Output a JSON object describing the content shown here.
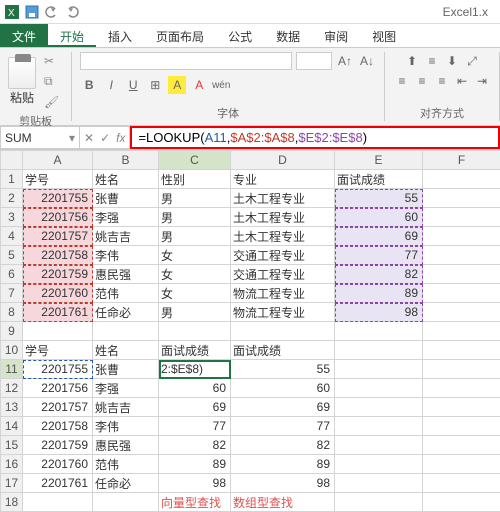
{
  "app": {
    "title": "Excel1.x"
  },
  "tabs": {
    "file": "文件",
    "home": "开始",
    "insert": "插入",
    "layout": "页面布局",
    "formulas": "公式",
    "data": "数据",
    "review": "审阅",
    "view": "视图"
  },
  "ribbon": {
    "paste_label": "粘贴",
    "clipboard_group": "剪贴板",
    "font_group": "字体",
    "align_group": "对齐方式",
    "bold": "B",
    "italic": "I",
    "underline": "U"
  },
  "formula_bar": {
    "name_box": "SUM",
    "cancel": "✕",
    "confirm": "✓",
    "fx": "fx",
    "formula_prefix": "=LOOKUP(",
    "arg1": "A11",
    "comma": ",",
    "arg2": "$A$2:$A$8",
    "arg3": "$E$2:$E$8",
    "formula_suffix": ")"
  },
  "columns": [
    "A",
    "B",
    "C",
    "D",
    "E",
    "F"
  ],
  "rows": [
    "1",
    "2",
    "3",
    "4",
    "5",
    "6",
    "7",
    "8",
    "9",
    "10",
    "11",
    "12",
    "13",
    "14",
    "15",
    "16",
    "17",
    "18"
  ],
  "headers_top": {
    "A": "学号",
    "B": "姓名",
    "C": "性别",
    "D": "专业",
    "E": "面试成绩"
  },
  "data_top": [
    {
      "A": "2201755",
      "B": "张曹",
      "C": "男",
      "D": "土木工程专业",
      "E": "55"
    },
    {
      "A": "2201756",
      "B": "李强",
      "C": "男",
      "D": "土木工程专业",
      "E": "60"
    },
    {
      "A": "2201757",
      "B": "姚吉吉",
      "C": "男",
      "D": "土木工程专业",
      "E": "69"
    },
    {
      "A": "2201758",
      "B": "李伟",
      "C": "女",
      "D": "交通工程专业",
      "E": "77"
    },
    {
      "A": "2201759",
      "B": "惠民强",
      "C": "女",
      "D": "交通工程专业",
      "E": "82"
    },
    {
      "A": "2201760",
      "B": "范伟",
      "C": "女",
      "D": "物流工程专业",
      "E": "89"
    },
    {
      "A": "2201761",
      "B": "任命必",
      "C": "男",
      "D": "物流工程专业",
      "E": "98"
    }
  ],
  "headers_bottom": {
    "A": "学号",
    "B": "姓名",
    "C": "面试成绩",
    "D": "面试成绩"
  },
  "data_bottom": [
    {
      "A": "2201755",
      "B": "张曹",
      "C": "2:$E$8)",
      "D": "55"
    },
    {
      "A": "2201756",
      "B": "李强",
      "C": "60",
      "D": "60"
    },
    {
      "A": "2201757",
      "B": "姚吉吉",
      "C": "69",
      "D": "69"
    },
    {
      "A": "2201758",
      "B": "李伟",
      "C": "77",
      "D": "77"
    },
    {
      "A": "2201759",
      "B": "惠民强",
      "C": "82",
      "D": "82"
    },
    {
      "A": "2201760",
      "B": "范伟",
      "C": "89",
      "D": "89"
    },
    {
      "A": "2201761",
      "B": "任命必",
      "C": "98",
      "D": "98"
    }
  ],
  "footer_note": {
    "C": "向量型查找",
    "D": "数组型查找"
  },
  "active_cell": "C11",
  "colors": {
    "accent": "#217346",
    "formula_border": "#e00000",
    "ref1": "#1e5aa8",
    "ref2": "#c0392b",
    "ref3": "#8e44ad"
  }
}
